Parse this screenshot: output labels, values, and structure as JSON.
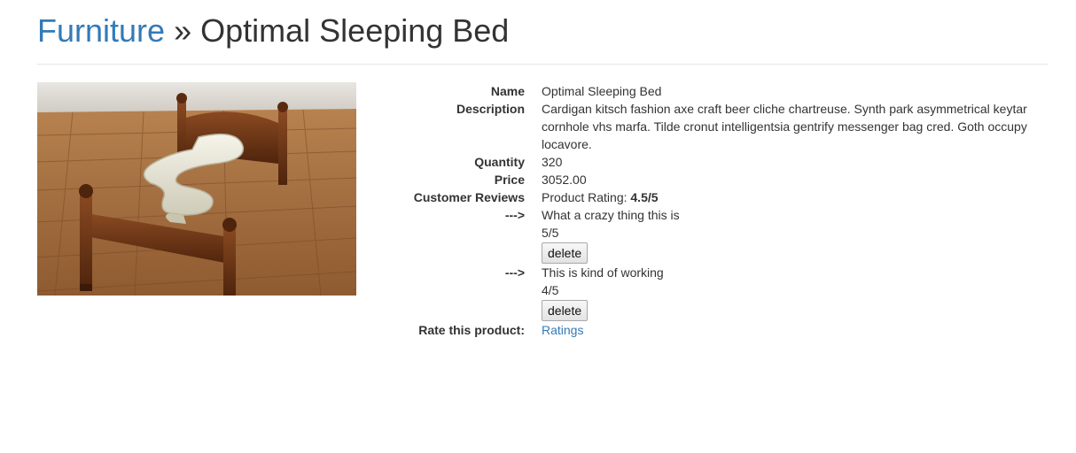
{
  "header": {
    "category_link": "Furniture",
    "separator": "»",
    "product_title": "Optimal Sleeping Bed"
  },
  "product_image": {
    "alt": "Optimal Sleeping Bed"
  },
  "details": {
    "name_label": "Name",
    "name_value": "Optimal Sleeping Bed",
    "description_label": "Description",
    "description_value": "Cardigan kitsch fashion axe craft beer cliche chartreuse. Synth park asymmetrical keytar cornhole vhs marfa. Tilde cronut intelligentsia gentrify messenger bag cred. Goth occupy locavore.",
    "quantity_label": "Quantity",
    "quantity_value": "320",
    "price_label": "Price",
    "price_value": "3052.00",
    "reviews_label": "Customer Reviews",
    "rating_prefix": "Product Rating: ",
    "rating_value": "4.5/5",
    "reviews": [
      {
        "arrow": "--->",
        "text": "What a crazy thing this is",
        "score": "5/5",
        "delete_label": "delete"
      },
      {
        "arrow": "--->",
        "text": "This is kind of working",
        "score": "4/5",
        "delete_label": "delete"
      }
    ],
    "rate_label": "Rate this product:",
    "rate_link": "Ratings"
  }
}
